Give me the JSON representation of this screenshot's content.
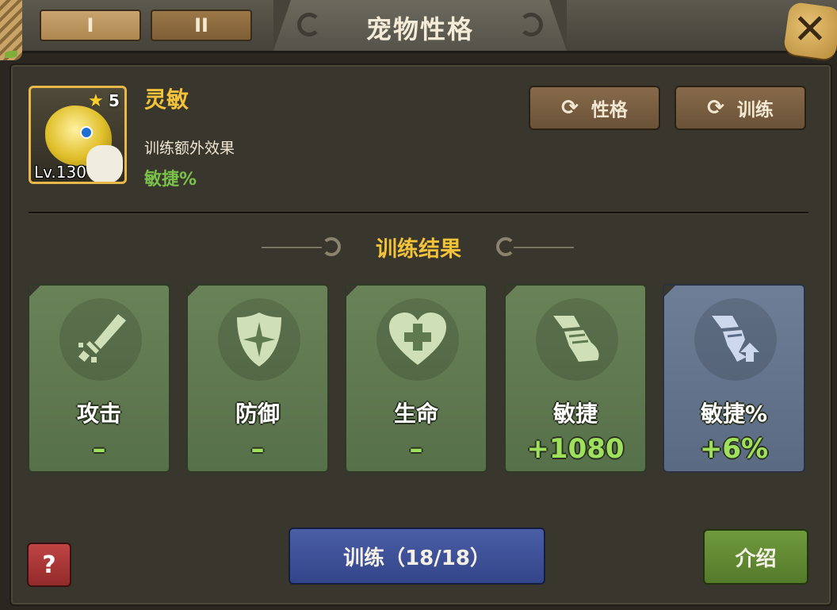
{
  "header": {
    "tabs": [
      "I",
      "II"
    ],
    "title": "宠物性格",
    "close_icon": "close-x-icon"
  },
  "pet": {
    "name": "灵敏",
    "stars": "5",
    "level": "Lv.130",
    "extra_label": "训练额外效果",
    "extra_value": "敏捷%"
  },
  "buttons": {
    "personality": "性格",
    "train_top": "训练",
    "help": "?",
    "train_main": "训练（18/18）",
    "intro": "介绍"
  },
  "section_title": "训练结果",
  "cards": [
    {
      "label": "攻击",
      "value": "–",
      "icon": "sword-icon",
      "style": "green"
    },
    {
      "label": "防御",
      "value": "–",
      "icon": "shield-icon",
      "style": "green"
    },
    {
      "label": "生命",
      "value": "–",
      "icon": "heart-icon",
      "style": "green"
    },
    {
      "label": "敏捷",
      "value": "+1080",
      "icon": "boot-icon",
      "style": "green"
    },
    {
      "label": "敏捷%",
      "value": "+6%",
      "icon": "boot-up-icon",
      "style": "blue"
    }
  ],
  "colors": {
    "accent_gold": "#f2c23a",
    "positive_green": "#9fe05c",
    "train_button_blue": "#3f529a",
    "intro_button_green": "#62893a"
  }
}
